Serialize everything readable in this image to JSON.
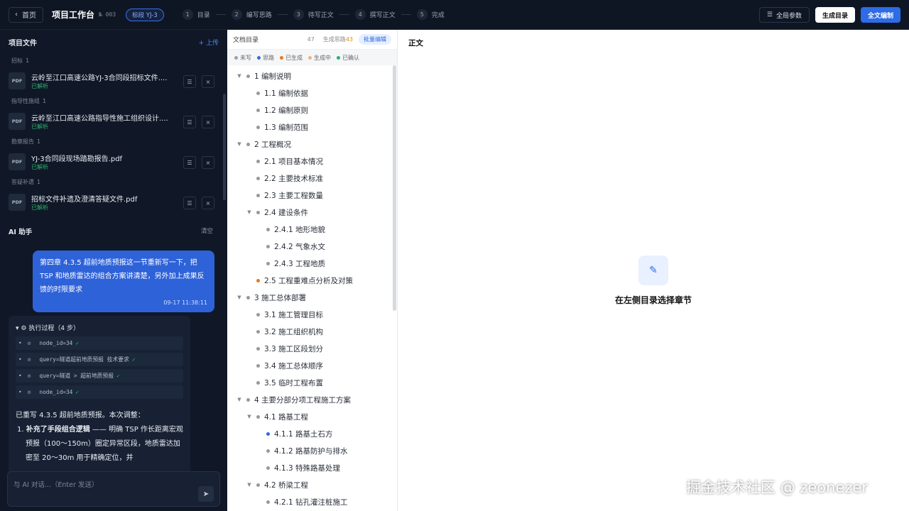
{
  "topbar": {
    "back": "首页",
    "title": "项目工作台",
    "doc_no": "№ 003",
    "stage": "标段 YJ-3",
    "steps": [
      {
        "num": "1",
        "label": "目录"
      },
      {
        "num": "2",
        "label": "编写思路"
      },
      {
        "num": "3",
        "label": "待写正文"
      },
      {
        "num": "4",
        "label": "撰写正文"
      },
      {
        "num": "5",
        "label": "完成"
      }
    ],
    "global_params": "全局参数",
    "generate_toc": "生成目录",
    "full_write": "全文编制"
  },
  "files": {
    "title": "项目文件",
    "upload": "+ 上传",
    "categories": [
      {
        "name": "招标",
        "count": "1",
        "file": "云岭至江口高速公路YJ-3合同段招标文件....",
        "status": "已解析"
      },
      {
        "name": "指导性施组",
        "count": "1",
        "file": "云岭至江口高速公路指导性施工组织设计....",
        "status": "已解析"
      },
      {
        "name": "勘察报告",
        "count": "1",
        "file": "YJ-3合同段现场踏勘报告.pdf",
        "status": "已解析"
      },
      {
        "name": "答疑补遗",
        "count": "1",
        "file": "招标文件补遗及澄清答疑文件.pdf",
        "status": "已解析"
      }
    ],
    "pdf": "PDF"
  },
  "ai": {
    "title": "AI 助手",
    "clear": "清空",
    "user_msg": "第四章 4.3.5 超前地质预报这一节重新写一下，把 TSP 和地质雷达的组合方案讲清楚，另外加上成果反馈的时限要求",
    "user_time": "09-17 11:38:11",
    "exec_title": "执行过程（4 步）",
    "exec_steps": [
      "node_id=34",
      "query=隧道超前地质预报 技术要求",
      "query=隧道 > 超前地质预报",
      "node_id=34"
    ],
    "result_intro": "已重写 4.3.5 超前地质预报。本次调整：",
    "result_bold": "补充了手段组合逻辑",
    "result_text": " —— 明确 TSP 作长距离宏观预报（100～150m）圈定异常区段，地质雷达加密至 20～30m 用于精确定位，并",
    "input_placeholder": "与 AI 对话...（Enter 发送）"
  },
  "toc": {
    "title": "文档目录",
    "count": "47",
    "gen_label": "生成思路",
    "gen_count": "43",
    "batch": "批量编辑",
    "legend": [
      {
        "label": "未写",
        "color": "#9aa0a8"
      },
      {
        "label": "思路",
        "color": "#2e6be6"
      },
      {
        "label": "已生成",
        "color": "#e67a1f"
      },
      {
        "label": "生成中",
        "color": "#f0b27a"
      },
      {
        "label": "已确认",
        "color": "#27b26b"
      }
    ],
    "items": [
      {
        "text": "1 编制说明",
        "level": 0,
        "arrow": "▼",
        "dot": ""
      },
      {
        "text": "1.1 编制依据",
        "level": 1,
        "arrow": "",
        "dot": ""
      },
      {
        "text": "1.2 编制原则",
        "level": 1,
        "arrow": "",
        "dot": ""
      },
      {
        "text": "1.3 编制范围",
        "level": 1,
        "arrow": "",
        "dot": ""
      },
      {
        "text": "2 工程概况",
        "level": 0,
        "arrow": "▼",
        "dot": ""
      },
      {
        "text": "2.1 项目基本情况",
        "level": 1,
        "arrow": "",
        "dot": ""
      },
      {
        "text": "2.2 主要技术标准",
        "level": 1,
        "arrow": "",
        "dot": ""
      },
      {
        "text": "2.3 主要工程数量",
        "level": 1,
        "arrow": "",
        "dot": ""
      },
      {
        "text": "2.4 建设条件",
        "level": 1,
        "arrow": "▼",
        "dot": ""
      },
      {
        "text": "2.4.1 地形地貌",
        "level": 2,
        "arrow": "",
        "dot": ""
      },
      {
        "text": "2.4.2 气象水文",
        "level": 2,
        "arrow": "",
        "dot": ""
      },
      {
        "text": "2.4.3 工程地质",
        "level": 2,
        "arrow": "",
        "dot": ""
      },
      {
        "text": "2.5 工程重难点分析及对策",
        "level": 1,
        "arrow": "",
        "dot": "orange"
      },
      {
        "text": "3 施工总体部署",
        "level": 0,
        "arrow": "▼",
        "dot": ""
      },
      {
        "text": "3.1 施工管理目标",
        "level": 1,
        "arrow": "",
        "dot": ""
      },
      {
        "text": "3.2 施工组织机构",
        "level": 1,
        "arrow": "",
        "dot": ""
      },
      {
        "text": "3.3 施工区段划分",
        "level": 1,
        "arrow": "",
        "dot": ""
      },
      {
        "text": "3.4 施工总体顺序",
        "level": 1,
        "arrow": "",
        "dot": ""
      },
      {
        "text": "3.5 临时工程布置",
        "level": 1,
        "arrow": "",
        "dot": ""
      },
      {
        "text": "4 主要分部分项工程施工方案",
        "level": 0,
        "arrow": "▼",
        "dot": ""
      },
      {
        "text": "4.1 路基工程",
        "level": 1,
        "arrow": "▼",
        "dot": ""
      },
      {
        "text": "4.1.1 路基土石方",
        "level": 2,
        "arrow": "",
        "dot": "blue"
      },
      {
        "text": "4.1.2 路基防护与排水",
        "level": 2,
        "arrow": "",
        "dot": ""
      },
      {
        "text": "4.1.3 特殊路基处理",
        "level": 2,
        "arrow": "",
        "dot": ""
      },
      {
        "text": "4.2 桥梁工程",
        "level": 1,
        "arrow": "▼",
        "dot": ""
      },
      {
        "text": "4.2.1 钻孔灌注桩施工",
        "level": 2,
        "arrow": "",
        "dot": ""
      }
    ]
  },
  "main": {
    "title": "正文",
    "empty": "在左侧目录选择章节",
    "edit_icon": "pencil-icon"
  },
  "watermark": "掘金技术社区 @ zeonezer"
}
